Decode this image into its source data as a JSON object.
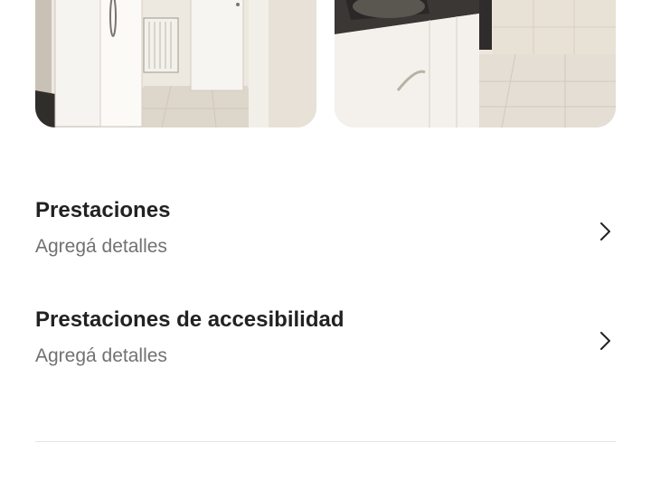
{
  "photos": [
    {
      "name": "photo-laundry-room"
    },
    {
      "name": "photo-kitchen"
    }
  ],
  "sections": [
    {
      "title": "Prestaciones",
      "subtitle": "Agregá detalles"
    },
    {
      "title": "Prestaciones de accesibilidad",
      "subtitle": "Agregá detalles"
    }
  ]
}
